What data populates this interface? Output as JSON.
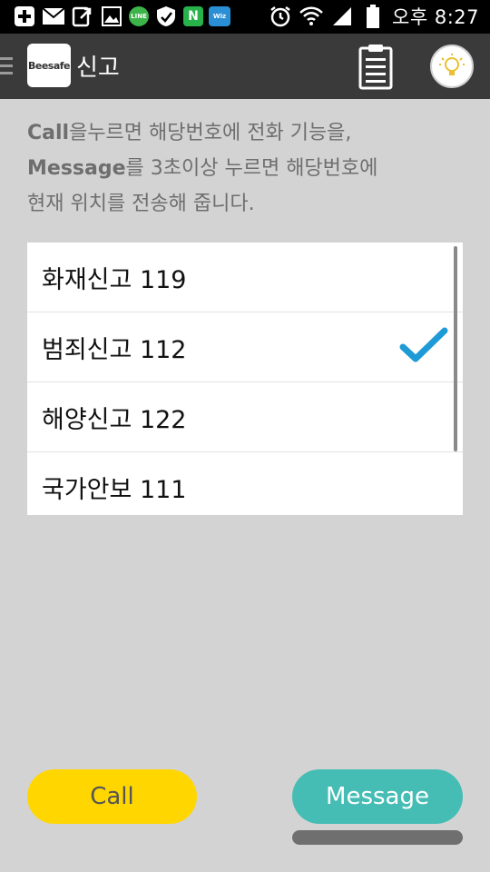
{
  "status_bar": {
    "icons": [
      "plus-icon",
      "mail-icon",
      "export-icon",
      "image-icon",
      "line-icon",
      "shield-icon",
      "naver-icon",
      "wifi-whiz-icon",
      "alarm-icon",
      "wifi-icon",
      "signal-icon",
      "battery-icon"
    ],
    "time": "오후 8:27",
    "line_label": "LINE",
    "n_label": "N",
    "wiz_label": "Wiz"
  },
  "action_bar": {
    "logo_text": "Beesafe",
    "title": "신고",
    "colors": {
      "background": "#3a3a3a",
      "title": "#ffffff"
    }
  },
  "instructions": {
    "line1_bold": "Call",
    "line1_rest": "을누르면 해당번호에 전화 기능을,",
    "line2_bold": "Message",
    "line2_rest": "를 3초이상 누르면 해당번호에",
    "line3": "현재 위치를 전송해 줍니다."
  },
  "list": {
    "items": [
      {
        "label": "화재신고 119",
        "checked": false
      },
      {
        "label": "범죄신고 112",
        "checked": true
      },
      {
        "label": "해양신고 122",
        "checked": false
      },
      {
        "label": "국가안보 111",
        "checked": false
      }
    ],
    "check_color": "#1e9ad6"
  },
  "buttons": {
    "call_label": "Call",
    "message_label": "Message",
    "call_color": "#ffd600",
    "message_color": "#45bdb4"
  }
}
